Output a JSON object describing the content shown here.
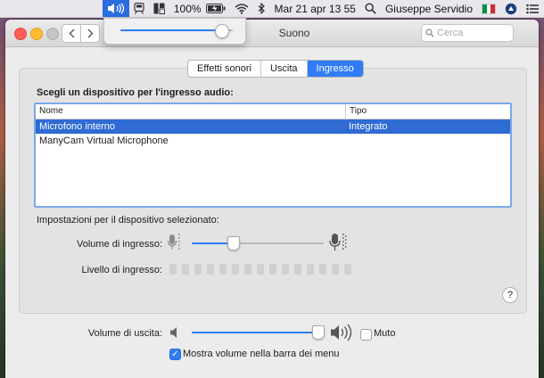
{
  "menubar": {
    "battery": "100%",
    "datetime": "Mar 21 apr  13 55",
    "user": "Giuseppe Servidio",
    "volume_popup_level": 0.9
  },
  "window": {
    "title": "Suono",
    "search_placeholder": "Cerca"
  },
  "tabs": [
    {
      "label": "Effetti sonori",
      "selected": false
    },
    {
      "label": "Uscita",
      "selected": false
    },
    {
      "label": "Ingresso",
      "selected": true
    }
  ],
  "input": {
    "heading": "Scegli un dispositivo per l'ingresso audio:",
    "columns": {
      "name": "Nome",
      "type": "Tipo"
    },
    "devices": [
      {
        "name": "Microfono interno",
        "type": "Integrato",
        "selected": true
      },
      {
        "name": "ManyCam Virtual Microphone",
        "type": "",
        "selected": false
      }
    ],
    "settings_label": "Impostazioni per il dispositivo selezionato:",
    "volume_label": "Volume di ingresso:",
    "volume_level": 0.31,
    "level_label": "Livello di ingresso:",
    "level_segments": 15,
    "level_active": 0
  },
  "output": {
    "volume_label": "Volume di uscita:",
    "volume_level": 0.95,
    "mute_label": "Muto",
    "mute_checked": false,
    "show_in_menu_label": "Mostra volume nella barra dei menu",
    "show_in_menu_checked": true
  },
  "help_label": "?",
  "colors": {
    "accent": "#2f7cf6",
    "selection": "#2f6bd3"
  }
}
